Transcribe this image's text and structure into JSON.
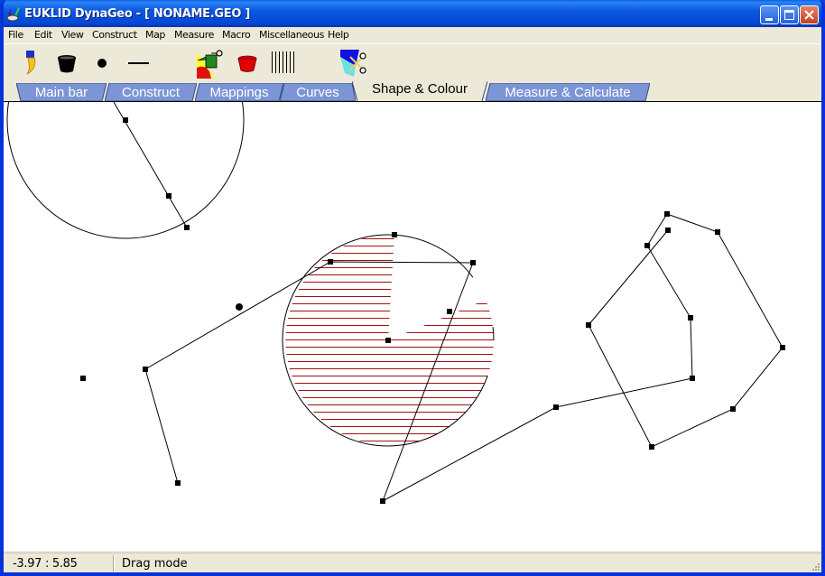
{
  "window": {
    "title": "EUKLID DynaGeo - [ NONAME.GEO ]",
    "controls": [
      "minimize",
      "maximize",
      "close"
    ]
  },
  "menubar": {
    "items": [
      {
        "label": "File"
      },
      {
        "label": "Edit"
      },
      {
        "label": "View"
      },
      {
        "label": "Construct"
      },
      {
        "label": "Map"
      },
      {
        "label": "Measure"
      },
      {
        "label": "Macro"
      },
      {
        "label": "Miscellaneous"
      },
      {
        "label": "Help"
      }
    ]
  },
  "toolbar": {
    "tools": [
      {
        "icon": "brush-icon",
        "tooltip": "Line colour"
      },
      {
        "icon": "black-bucket-icon",
        "tooltip": "Fill black"
      },
      {
        "icon": "point-style-icon",
        "tooltip": "Point style"
      },
      {
        "icon": "line-style-icon",
        "tooltip": "Line style"
      },
      {
        "icon": "watering-can-icon",
        "tooltip": "Fill colour"
      },
      {
        "icon": "red-bucket-icon",
        "tooltip": "Fill red"
      },
      {
        "icon": "hatch-pattern-icon",
        "tooltip": "Hatching"
      },
      {
        "icon": "scissors-icon",
        "tooltip": "Cut"
      }
    ]
  },
  "tabs": {
    "items": [
      {
        "label": "Main bar",
        "active": false
      },
      {
        "label": "Construct",
        "active": false
      },
      {
        "label": "Mappings",
        "active": false
      },
      {
        "label": "Curves",
        "active": false
      },
      {
        "label": "Shape & Colour",
        "active": true
      },
      {
        "label": "Measure & Calculate",
        "active": false
      }
    ],
    "inactive_color": "#7b95d6",
    "active_color": "#ece9d8"
  },
  "canvas": {
    "hatch_color": "#a01010",
    "line_color": "#000000",
    "background": "#ffffff"
  },
  "statusbar": {
    "coordinates": "-3.97 : 5.85",
    "mode": "Drag mode"
  }
}
